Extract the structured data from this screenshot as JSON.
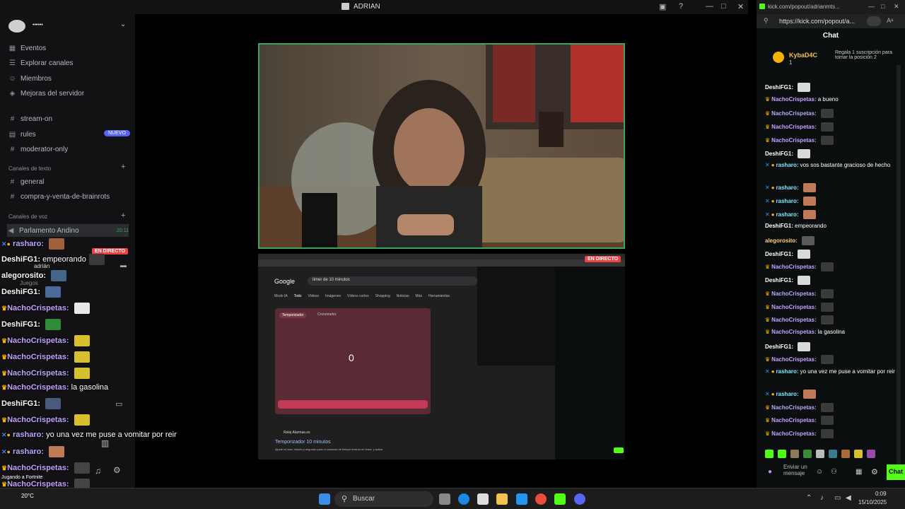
{
  "window": {
    "title": "ADRIAN"
  },
  "server": {
    "name": "••••••"
  },
  "sidebar": {
    "items": [
      {
        "label": "Eventos",
        "icon": "calendar-icon"
      },
      {
        "label": "Explorar canales",
        "icon": "compass-icon"
      },
      {
        "label": "Miembros",
        "icon": "members-icon"
      },
      {
        "label": "Mejoras del servidor",
        "icon": "boost-icon"
      }
    ],
    "channels_top": [
      {
        "label": "stream-on",
        "icon": "hash-icon"
      },
      {
        "label": "rules",
        "icon": "rules-icon",
        "badge": "NUEVO"
      },
      {
        "label": "moderator-only",
        "icon": "hash-icon"
      }
    ],
    "text_section": "Canales de texto",
    "text_channels": [
      "general",
      "compra-y-venta-de-brainrots"
    ],
    "voice_section": "Canales de voz",
    "voice_channel": "Parlamento Andino",
    "voice_time": "20:11",
    "voice_user": "adrián",
    "voice_user_status": "Juegos",
    "live_label": "EN DIRECTO"
  },
  "overlay_chat": [
    {
      "user": "rasharo:",
      "msg": "",
      "type": "badge"
    },
    {
      "user": "DeshiFG1:",
      "msg": "empeorando",
      "type": "plain"
    },
    {
      "user": "alegorosito:",
      "msg": "",
      "type": "plain"
    },
    {
      "user": "DeshiFG1:",
      "msg": "",
      "type": "plain"
    },
    {
      "user": "NachoCrispetas:",
      "msg": "",
      "type": "crown"
    },
    {
      "user": "DeshiFG1:",
      "msg": "",
      "type": "plain"
    },
    {
      "user": "NachoCrispetas:",
      "msg": "",
      "type": "crown"
    },
    {
      "user": "NachoCrispetas:",
      "msg": "",
      "type": "crown"
    },
    {
      "user": "NachoCrispetas:",
      "msg": "",
      "type": "crown"
    },
    {
      "user": "NachoCrispetas:",
      "msg": "la gasolina",
      "type": "crown"
    },
    {
      "user": "DeshiFG1:",
      "msg": "",
      "type": "plain"
    },
    {
      "user": "NachoCrispetas:",
      "msg": "",
      "type": "crown"
    },
    {
      "user": "rasharo:",
      "msg": "yo una vez me puse a vomitar por reir",
      "type": "badge"
    },
    {
      "user": "rasharo:",
      "msg": "",
      "type": "badge"
    },
    {
      "user": "NachoCrispetas:",
      "msg": "",
      "type": "crown"
    },
    {
      "user": "NachoCrispetas:",
      "msg": "",
      "type": "crown"
    },
    {
      "user": "NachoCrispetas:",
      "msg": "",
      "type": "crown"
    }
  ],
  "overlay_extra": {
    "game": "Jugando a Fortnite",
    "temp": "20°C"
  },
  "screenshare": {
    "search_query": "timer de 10 minutos",
    "google": "Google",
    "tabs": [
      "Modo IA",
      "Todo",
      "Vídeos",
      "Imágenes",
      "Vídeos cortos",
      "Shopping",
      "Noticias",
      "Más",
      "Herramientas"
    ],
    "timer_tab": "Temporizador",
    "stopwatch_tab": "Cronómetro",
    "timer_value": "0",
    "result_title": "Temporizador 10 minutos",
    "result_site": "Reloj Alarmas.es",
    "result_text": "Ajuste la hora, minuto y segundo para el contador de tiempo inverso en línea, y active."
  },
  "kick": {
    "url": "https://kick.com/popout/a...",
    "tab_title": "kick.com/popout/adrianmts...",
    "header": "Chat",
    "pinned_user": "KybaD4C",
    "pinned_count": "1",
    "pinned_text": "Regala 1 suscripción para tomar la posición 2",
    "messages": [
      {
        "user": "DeshiFG1:",
        "msg": "",
        "crown": false,
        "color": "#ffffff"
      },
      {
        "user": "NachoCrispetas:",
        "msg": "a bueno",
        "crown": true,
        "color": "#c0a4ff"
      },
      {
        "user": "NachoCrispetas:",
        "msg": "",
        "crown": true,
        "color": "#c0a4ff"
      },
      {
        "user": "NachoCrispetas:",
        "msg": "",
        "crown": true,
        "color": "#c0a4ff"
      },
      {
        "user": "NachoCrispetas:",
        "msg": "",
        "crown": true,
        "color": "#c0a4ff"
      },
      {
        "user": "DeshiFG1:",
        "msg": "",
        "crown": false,
        "color": "#ffffff"
      },
      {
        "user": "rasharo:",
        "msg": "vos sos bastante gracioso de hecho",
        "crown": false,
        "color": "#7fe9ff"
      },
      {
        "user": "rasharo:",
        "msg": "",
        "crown": false,
        "color": "#7fe9ff"
      },
      {
        "user": "rasharo:",
        "msg": "",
        "crown": false,
        "color": "#7fe9ff"
      },
      {
        "user": "rasharo:",
        "msg": "",
        "crown": false,
        "color": "#7fe9ff"
      },
      {
        "user": "DeshiFG1:",
        "msg": "empeorando",
        "crown": false,
        "color": "#ffffff"
      },
      {
        "user": "alegorosito:",
        "msg": "",
        "crown": false,
        "color": "#ffd36b"
      },
      {
        "user": "DeshiFG1:",
        "msg": "",
        "crown": false,
        "color": "#ffffff"
      },
      {
        "user": "NachoCrispetas:",
        "msg": "",
        "crown": true,
        "color": "#c0a4ff"
      },
      {
        "user": "DeshiFG1:",
        "msg": "",
        "crown": false,
        "color": "#ffffff"
      },
      {
        "user": "NachoCrispetas:",
        "msg": "",
        "crown": true,
        "color": "#c0a4ff"
      },
      {
        "user": "NachoCrispetas:",
        "msg": "",
        "crown": true,
        "color": "#c0a4ff"
      },
      {
        "user": "NachoCrispetas:",
        "msg": "",
        "crown": true,
        "color": "#c0a4ff"
      },
      {
        "user": "NachoCrispetas:",
        "msg": "la gasolina",
        "crown": true,
        "color": "#c0a4ff"
      },
      {
        "user": "DeshiFG1:",
        "msg": "",
        "crown": false,
        "color": "#ffffff"
      },
      {
        "user": "NachoCrispetas:",
        "msg": "",
        "crown": true,
        "color": "#c0a4ff"
      },
      {
        "user": "rasharo:",
        "msg": "yo una vez me puse a vomitar por reir",
        "crown": false,
        "color": "#7fe9ff"
      },
      {
        "user": "rasharo:",
        "msg": "",
        "crown": false,
        "color": "#7fe9ff"
      },
      {
        "user": "NachoCrispetas:",
        "msg": "",
        "crown": true,
        "color": "#c0a4ff"
      },
      {
        "user": "NachoCrispetas:",
        "msg": "",
        "crown": true,
        "color": "#c0a4ff"
      },
      {
        "user": "NachoCrispetas:",
        "msg": "",
        "crown": true,
        "color": "#c0a4ff"
      }
    ],
    "input_placeholder": "Enviar un mensaje",
    "send_label": "Chat"
  },
  "taskbar": {
    "search": "Buscar",
    "time": "0:09",
    "date": "15/10/2025"
  },
  "colors": {
    "accent": "#5865f2",
    "live": "#ed4245",
    "kick_green": "#53fc18",
    "crown": "#f2b400"
  }
}
